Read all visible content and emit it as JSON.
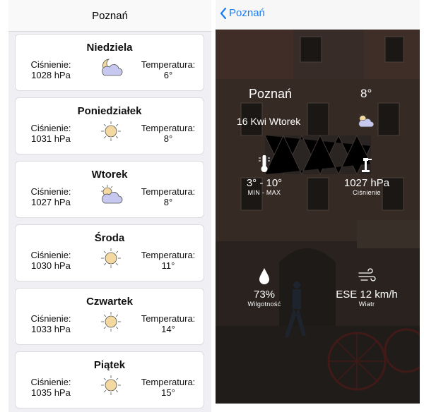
{
  "left": {
    "title": "Poznań",
    "days": [
      {
        "day": "Niedziela",
        "pressure_label": "Ciśnienie:",
        "pressure": "1028 hPa",
        "temp_label": "Temperatura:",
        "temp": "6°",
        "icon": "moon-cloud-icon"
      },
      {
        "day": "Poniedziałek",
        "pressure_label": "Ciśnienie:",
        "pressure": "1031 hPa",
        "temp_label": "Temperatura:",
        "temp": "8°",
        "icon": "sun-icon"
      },
      {
        "day": "Wtorek",
        "pressure_label": "Ciśnienie:",
        "pressure": "1027 hPa",
        "temp_label": "Temperatura:",
        "temp": "8°",
        "icon": "sun-cloud-icon"
      },
      {
        "day": "Środa",
        "pressure_label": "Ciśnienie:",
        "pressure": "1030 hPa",
        "temp_label": "Temperatura:",
        "temp": "11°",
        "icon": "sun-icon"
      },
      {
        "day": "Czwartek",
        "pressure_label": "Ciśnienie:",
        "pressure": "1033 hPa",
        "temp_label": "Temperatura:",
        "temp": "14°",
        "icon": "sun-icon"
      },
      {
        "day": "Piątek",
        "pressure_label": "Ciśnienie:",
        "pressure": "1035 hPa",
        "temp_label": "Temperatura:",
        "temp": "15°",
        "icon": "sun-icon"
      }
    ]
  },
  "right": {
    "back_label": "Poznań",
    "city": "Poznań",
    "temp": "8°",
    "date": "16 Kwi Wtorek",
    "date_icon": "sun-cloud-icon",
    "stats": {
      "minmax": {
        "value": "3° - 10°",
        "label": "MIN - MAX",
        "icon": "thermometer-icon"
      },
      "pressure": {
        "value": "1027 hPa",
        "label": "Ciśnienie",
        "icon": "barometer-icon"
      },
      "humidity": {
        "value": "73%",
        "label": "Wilgotność",
        "icon": "drop-icon"
      },
      "wind": {
        "value": "ESE 12 km/h",
        "label": "Wiatr",
        "icon": "wind-icon"
      }
    }
  },
  "colors": {
    "accent": "#1a7cf5",
    "icon_sun": "#f3d9a0",
    "icon_cloud": "#c6c8f0"
  }
}
